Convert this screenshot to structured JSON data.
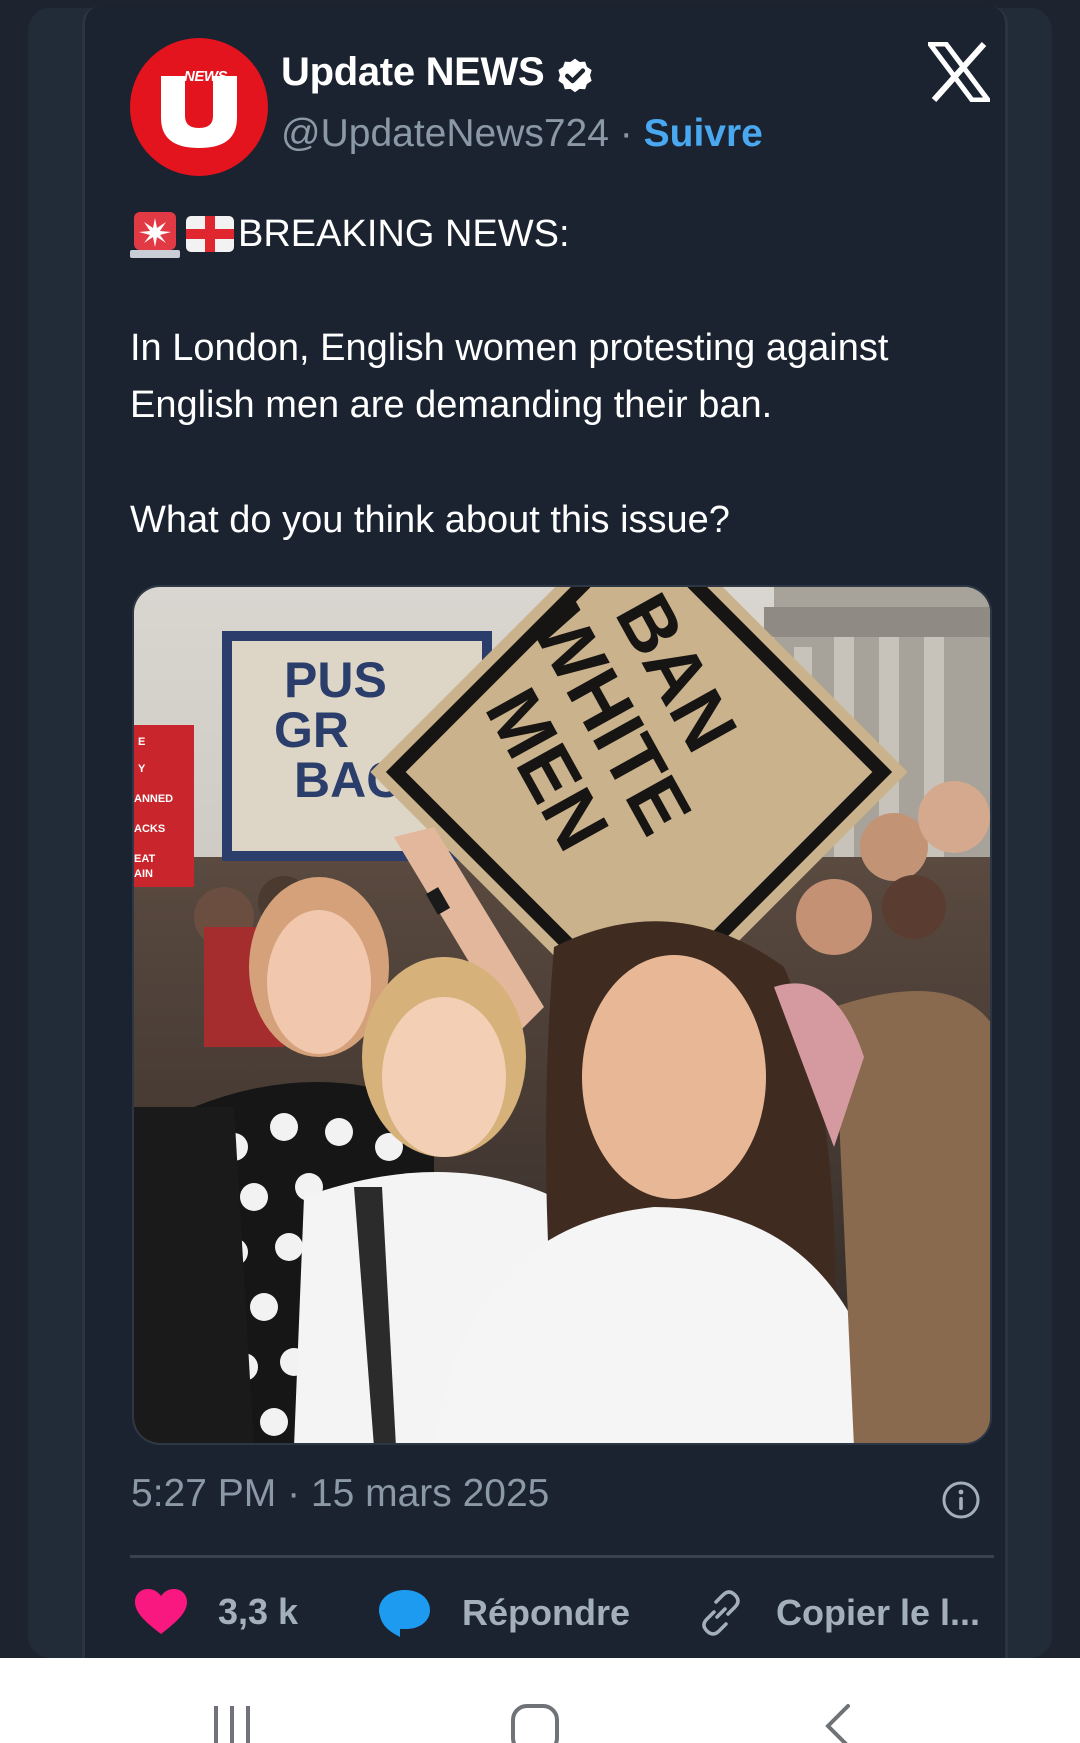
{
  "tweet": {
    "author_name": "Update NEWS",
    "avatar_tag": "NEWS",
    "handle": "@UpdateNews724",
    "separator": " · ",
    "follow_label": "Suivre",
    "headline": "BREAKING NEWS:",
    "body": "In London, English women protesting against English men are demanding their ban.",
    "question": "What do you think about this issue?",
    "timestamp": "5:27 PM · 15 mars 2025"
  },
  "photo": {
    "signs": {
      "left_sign_lines": [
        "PUS",
        "GR",
        "BAC"
      ],
      "diamond_sign_lines": [
        "BAN",
        "WHITE",
        "MEN"
      ],
      "red_sign_lines": [
        "E",
        "Y",
        "ANNED",
        "ACKS",
        "EAT",
        "AIN"
      ]
    }
  },
  "actions": {
    "like_count": "3,3 k",
    "reply_label": "Répondre",
    "copy_label": "Copier le l..."
  },
  "icons": {
    "brand_logo": "x-logo-icon",
    "verified": "verified-badge-icon",
    "info": "info-icon",
    "like": "heart-icon",
    "reply": "speech-bubble-icon",
    "copy": "link-icon"
  },
  "colors": {
    "background": "#1b2330",
    "accent_link": "#4aa8f0",
    "like_pink": "#f91880",
    "reply_blue": "#1d9bf0",
    "avatar_red": "#e3141d"
  }
}
